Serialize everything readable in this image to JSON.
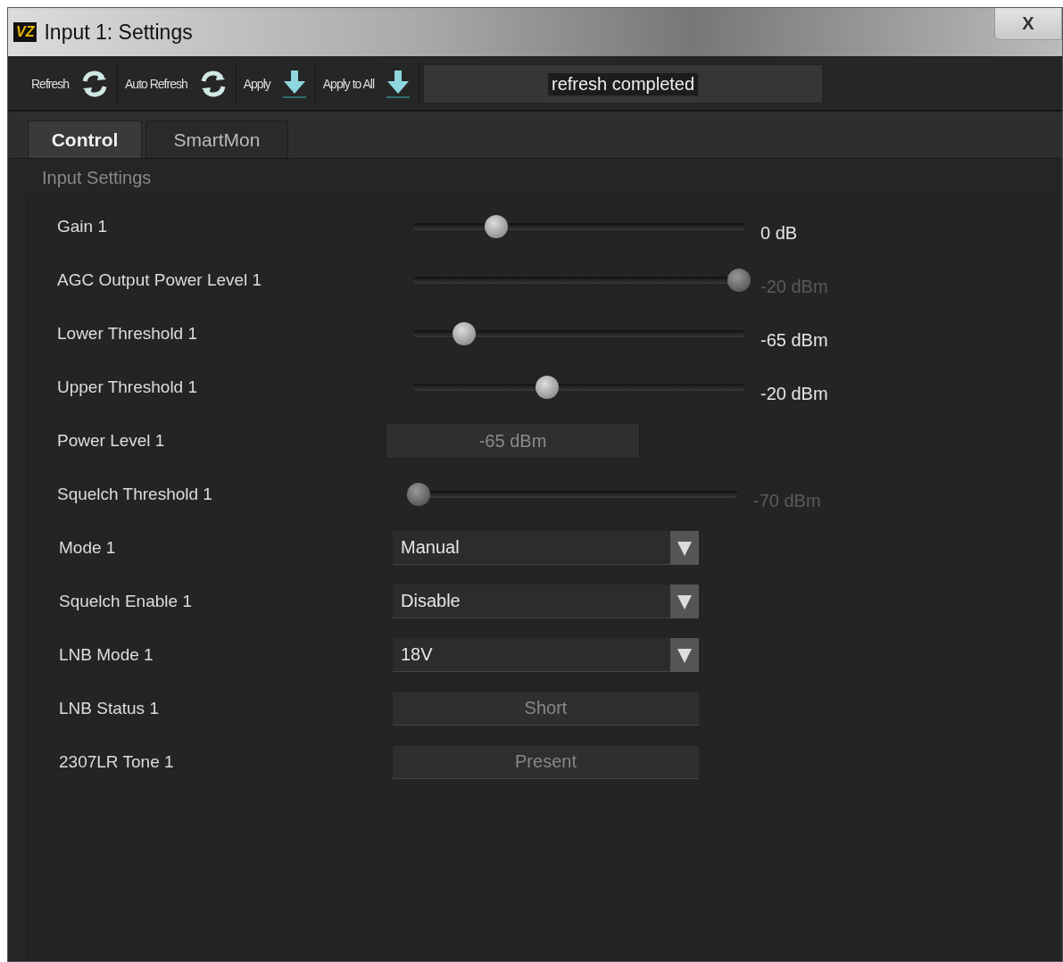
{
  "window": {
    "logo": "VZ",
    "title": "Input 1: Settings",
    "close": "X"
  },
  "toolbar": {
    "buttons": [
      {
        "label": "Refresh",
        "kind": "refresh"
      },
      {
        "label": "Auto Refresh",
        "kind": "refresh"
      },
      {
        "label": "Apply",
        "kind": "apply"
      },
      {
        "label": "Apply to All",
        "kind": "apply"
      }
    ],
    "status": "refresh completed"
  },
  "tabs": [
    {
      "label": "Control",
      "selected": true
    },
    {
      "label": "SmartMon",
      "selected": false
    }
  ],
  "section": {
    "title": "Input Settings"
  },
  "rows": [
    {
      "kind": "slider",
      "label": "Gain 1",
      "level": 0.24,
      "reading": "0 dB",
      "disabled": false
    },
    {
      "kind": "slider",
      "label": "AGC Output Power Level 1",
      "level": 1,
      "reading": "-20 dBm",
      "disabled": true
    },
    {
      "kind": "slider",
      "label": "Lower Threshold 1",
      "level": 0.14,
      "reading": "-65 dBm",
      "disabled": false
    },
    {
      "kind": "slider",
      "label": "Upper Threshold 1",
      "level": 0.4,
      "reading": "-20 dBm",
      "disabled": false
    },
    {
      "kind": "readout",
      "label": "Power Level 1",
      "value": "-65 dBm"
    },
    {
      "kind": "slider",
      "label": "Squelch Threshold 1",
      "level": 0.02,
      "reading": "-70 dBm",
      "disabled": true
    },
    {
      "kind": "select",
      "label": "Mode 1",
      "value": "Manual"
    },
    {
      "kind": "select",
      "label": "Squelch Enable 1",
      "value": "Disable"
    },
    {
      "kind": "select",
      "label": "LNB Mode 1",
      "value": "18V"
    },
    {
      "kind": "status",
      "label": "LNB Status 1",
      "value": "Short"
    },
    {
      "kind": "status",
      "label": "2307LR Tone  1",
      "value": "Present"
    }
  ]
}
